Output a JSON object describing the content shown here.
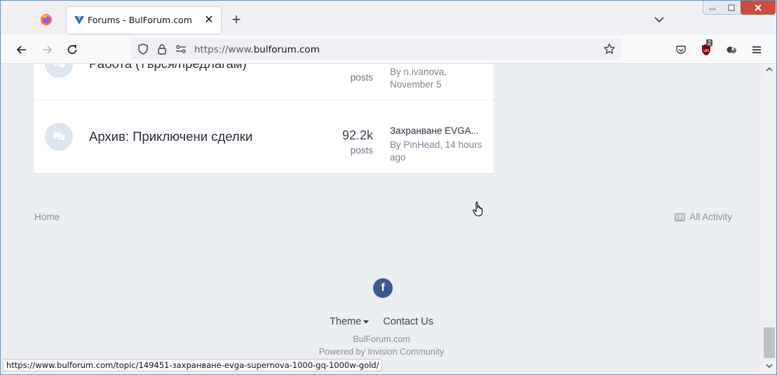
{
  "browser": {
    "tab": {
      "title": "Forums - BulForum.com",
      "close": "✕"
    },
    "new_tab": "+",
    "url": {
      "scheme": "https://www.",
      "domain": "bulforum.com"
    },
    "toolbar_badge": "2"
  },
  "forum_rows": [
    {
      "title": "Работа (търся/предлагам)",
      "posts_label": "posts",
      "last_meta": "By n.ivanova, November 5"
    },
    {
      "title": "Архив: Приключени сделки",
      "posts_count": "92.2k",
      "posts_label": "posts",
      "last_title": "Захранване EVGA...",
      "last_meta": "By PinHead, 14 hours ago"
    }
  ],
  "footer": {
    "home": "Home",
    "all_activity": "All Activity",
    "theme": "Theme",
    "contact": "Contact Us",
    "brand": "BulForum.com",
    "powered": "Powered by Invision Community"
  },
  "status_url": "https://www.bulforum.com/topic/149451-захранване-evga-supernova-1000-gq-1000w-gold/",
  "colors": {
    "accent": "#3b5998",
    "page_bg": "#ebeef2",
    "window_close": "#c94c3f"
  }
}
